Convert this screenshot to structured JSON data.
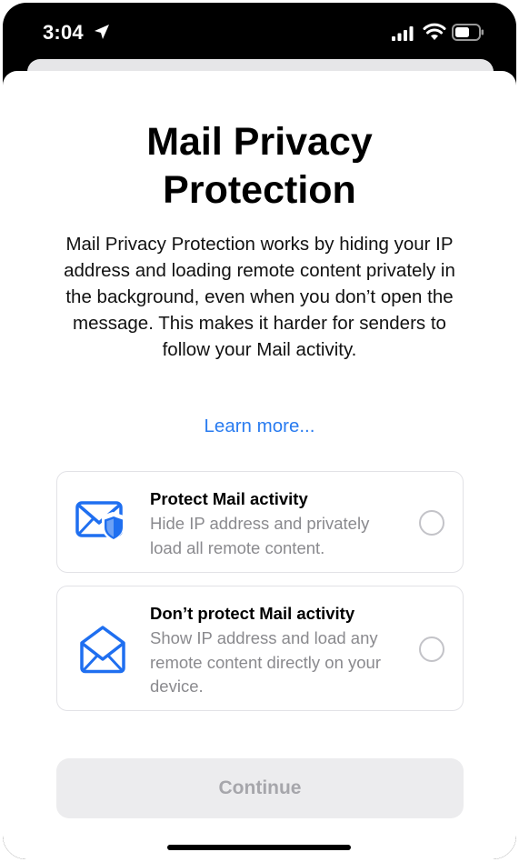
{
  "status_bar": {
    "time": "3:04",
    "icons": [
      "location-arrow-icon",
      "cellular-signal-icon",
      "wifi-icon",
      "battery-icon"
    ]
  },
  "sheet": {
    "title": "Mail Privacy Protection",
    "description": "Mail Privacy Protection works by hiding your IP address and loading remote content privately in the background, even when you don’t open the message. This makes it harder for senders to follow your Mail activity.",
    "learn_more": "Learn more..."
  },
  "options": [
    {
      "title": "Protect Mail activity",
      "description": "Hide IP address and privately load all remote content.",
      "icon": "envelope-shield-icon",
      "selected": false
    },
    {
      "title": "Don’t protect Mail activity",
      "description": "Show IP address and load any remote content directly on your device.",
      "icon": "envelope-open-icon",
      "selected": false
    }
  ],
  "continue_label": "Continue",
  "colors": {
    "accent": "#2a7cf0",
    "icon_blue": "#1f6ff0",
    "disabled_text": "#a6a6ab",
    "secondary_text": "#8a8a8e"
  }
}
